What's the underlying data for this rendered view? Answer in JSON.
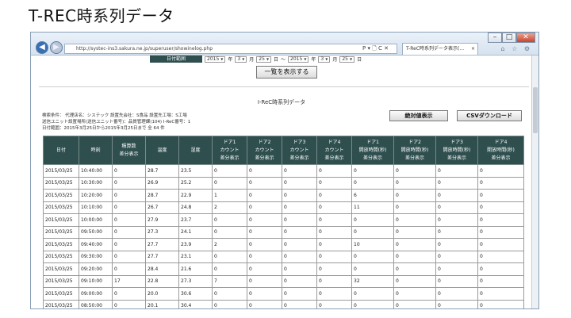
{
  "slide_title": "T-REC時系列データ",
  "browser": {
    "address": "http://systec-ins3.sakura.ne.jp/superuser/showinelog.php",
    "address_icons": "P ▾ 🗋 C ✕",
    "tab_title": "T-ReC時系列データ表示(...",
    "tab_close": "×",
    "nav_back": "◀",
    "nav_forward": "▶",
    "window_minimize": "–",
    "window_maximize": "□",
    "window_close": "✕",
    "tool_icons": "⌂ ☆ ⚙"
  },
  "date_filter": {
    "label": "日付範囲",
    "from_year": "2015",
    "unit_year": "年",
    "from_month": "3",
    "unit_month": "月",
    "from_day": "25",
    "unit_day": "日",
    "separator": "～",
    "to_year": "2015",
    "to_month": "3",
    "to_day": "25"
  },
  "show_button": "一覧を表示する",
  "report_title": "I-ReC時系列データ",
  "conditions": {
    "line1": "検索条件：  代理店名：システック   設置先会社：S食品   設置先工場：S工場",
    "line2": "送信ユニット設置場所(送信ユニット番号)：品質管理課(104)   I-ReC番号：1",
    "line3": "日付範囲：2015年3月25日から2015年3月25日まで       全 64 件"
  },
  "absolute_button": "絶対値表示",
  "csv_button": "CSVダウンロード",
  "table": {
    "headers": [
      "日付",
      "時刻",
      "積算数\n差分表示",
      "温度",
      "湿度",
      "ドア1\nカウント\n差分表示",
      "ドア2\nカウント\n差分表示",
      "ドア3\nカウント\n差分表示",
      "ドア4\nカウント\n差分表示",
      "ドア1\n開放時間(秒)\n差分表示",
      "ドア2\n開放時間(秒)\n差分表示",
      "ドア3\n開放時間(秒)\n差分表示",
      "ドア4\n開放時間(秒)\n差分表示"
    ],
    "rows": [
      [
        "2015/03/25",
        "10:40:00",
        "0",
        "28.7",
        "23.5",
        "0",
        "0",
        "0",
        "0",
        "0",
        "0",
        "0",
        "0"
      ],
      [
        "2015/03/25",
        "10:30:00",
        "0",
        "26.9",
        "25.2",
        "0",
        "0",
        "0",
        "0",
        "0",
        "0",
        "0",
        "0"
      ],
      [
        "2015/03/25",
        "10:20:00",
        "0",
        "28.7",
        "22.9",
        "1",
        "0",
        "0",
        "0",
        "6",
        "0",
        "0",
        "0"
      ],
      [
        "2015/03/25",
        "10:10:00",
        "0",
        "26.7",
        "24.8",
        "2",
        "0",
        "0",
        "0",
        "11",
        "0",
        "0",
        "0"
      ],
      [
        "2015/03/25",
        "10:00:00",
        "0",
        "27.9",
        "23.7",
        "0",
        "0",
        "0",
        "0",
        "0",
        "0",
        "0",
        "0"
      ],
      [
        "2015/03/25",
        "09:50:00",
        "0",
        "27.3",
        "24.1",
        "0",
        "0",
        "0",
        "0",
        "0",
        "0",
        "0",
        "0"
      ],
      [
        "2015/03/25",
        "09:40:00",
        "0",
        "27.7",
        "23.9",
        "2",
        "0",
        "0",
        "0",
        "10",
        "0",
        "0",
        "0"
      ],
      [
        "2015/03/25",
        "09:30:00",
        "0",
        "27.7",
        "23.1",
        "0",
        "0",
        "0",
        "0",
        "0",
        "0",
        "0",
        "0"
      ],
      [
        "2015/03/25",
        "09:20:00",
        "0",
        "28.4",
        "21.6",
        "0",
        "0",
        "0",
        "0",
        "0",
        "0",
        "0",
        "0"
      ],
      [
        "2015/03/25",
        "09:10:00",
        "17",
        "22.8",
        "27.3",
        "7",
        "0",
        "0",
        "0",
        "32",
        "0",
        "0",
        "0"
      ],
      [
        "2015/03/25",
        "09:00:00",
        "0",
        "20.0",
        "30.6",
        "0",
        "0",
        "0",
        "0",
        "0",
        "0",
        "0",
        "0"
      ],
      [
        "2015/03/25",
        "08:50:00",
        "0",
        "20.1",
        "30.4",
        "0",
        "0",
        "0",
        "0",
        "0",
        "0",
        "0",
        "0"
      ]
    ]
  }
}
